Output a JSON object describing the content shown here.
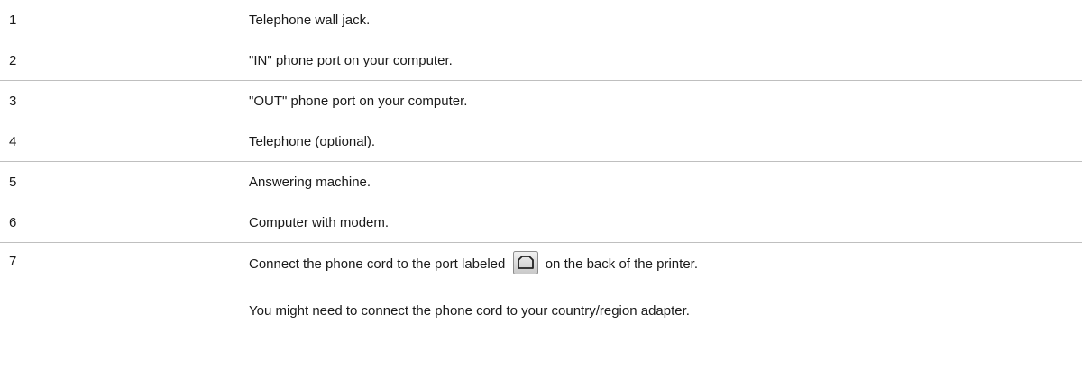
{
  "rows": [
    {
      "num": "1",
      "desc": "Telephone wall jack."
    },
    {
      "num": "2",
      "desc": "\"IN\" phone port on your computer."
    },
    {
      "num": "3",
      "desc": "\"OUT\" phone port on your computer."
    },
    {
      "num": "4",
      "desc": "Telephone (optional)."
    },
    {
      "num": "5",
      "desc": "Answering machine."
    },
    {
      "num": "6",
      "desc": "Computer with modem."
    }
  ],
  "row7": {
    "num": "7",
    "line1_before": "Connect the phone cord to the port labeled",
    "icon": "phone-port-icon",
    "line1_after": "on the back of the printer.",
    "line2": "You might need to connect the phone cord to your country/region adapter."
  }
}
